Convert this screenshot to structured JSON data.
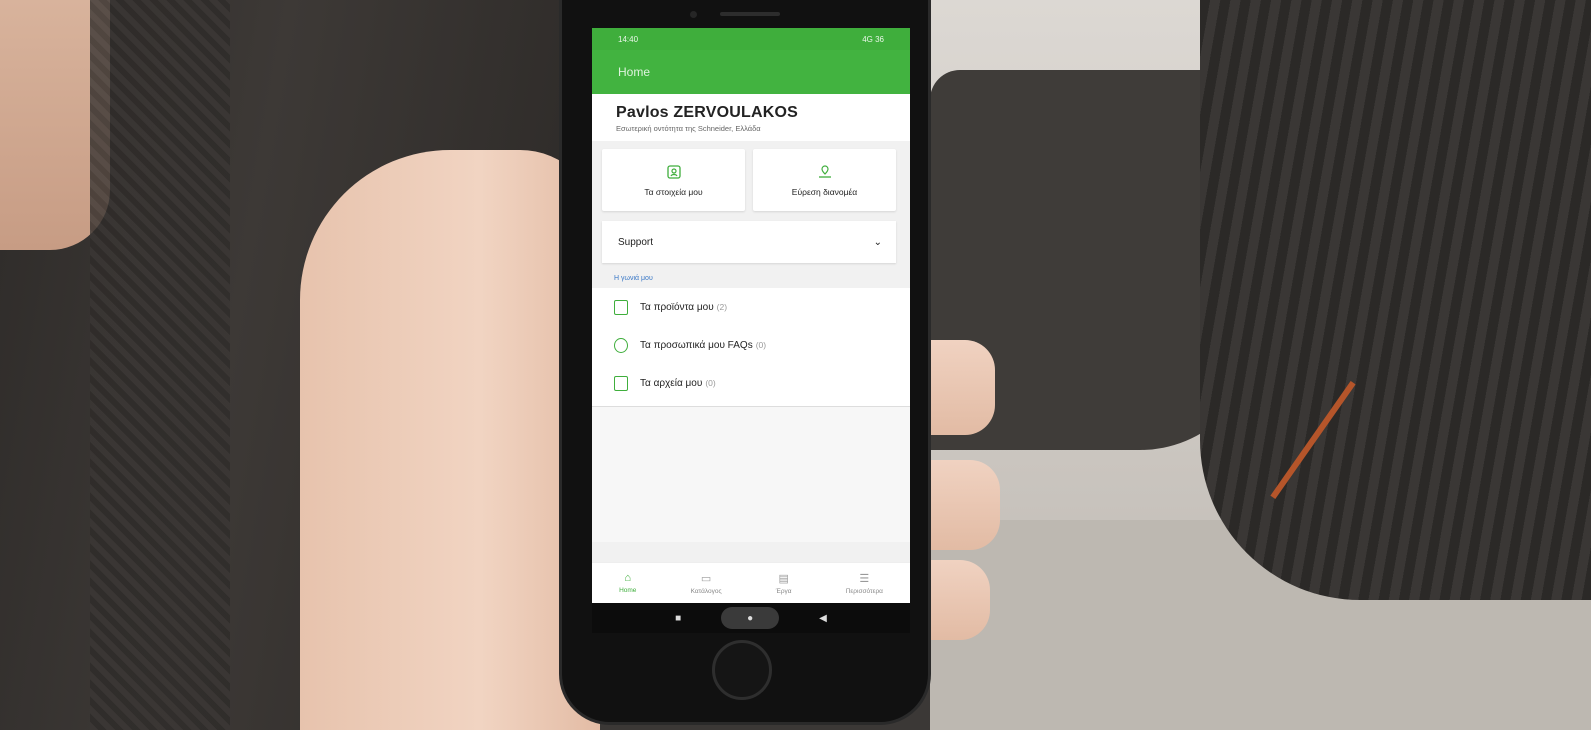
{
  "status": {
    "time": "14:40",
    "network": "4G",
    "battery": "36"
  },
  "appbar": {
    "title": "Home"
  },
  "profile": {
    "name": "Pavlos ZERVOULAKOS",
    "subtitle": "Εσωτερική οντότητα της Schneider, Ελλάδα"
  },
  "cards": [
    {
      "label": "Τα στοιχεία μου",
      "icon": "id-card-icon"
    },
    {
      "label": "Εύρεση διανομέα",
      "icon": "distributor-icon"
    }
  ],
  "support": {
    "label": "Support"
  },
  "section": {
    "title": "Η γωνιά μου"
  },
  "list": [
    {
      "label": "Τα προϊόντα μου",
      "count": "(2)",
      "icon": "products-icon"
    },
    {
      "label": "Τα προσωπικά μου FAQs",
      "count": "(0)",
      "icon": "faq-icon"
    },
    {
      "label": "Τα αρχεία μου",
      "count": "(0)",
      "icon": "files-icon"
    }
  ],
  "bottomnav": [
    {
      "label": "Home",
      "icon": "home-icon",
      "active": true
    },
    {
      "label": "Κατάλογος",
      "icon": "catalog-icon"
    },
    {
      "label": "Έργα",
      "icon": "folder-icon"
    },
    {
      "label": "Περισσότερα",
      "icon": "menu-icon"
    }
  ],
  "colors": {
    "accent": "#42b340",
    "link": "#3a78c6"
  }
}
